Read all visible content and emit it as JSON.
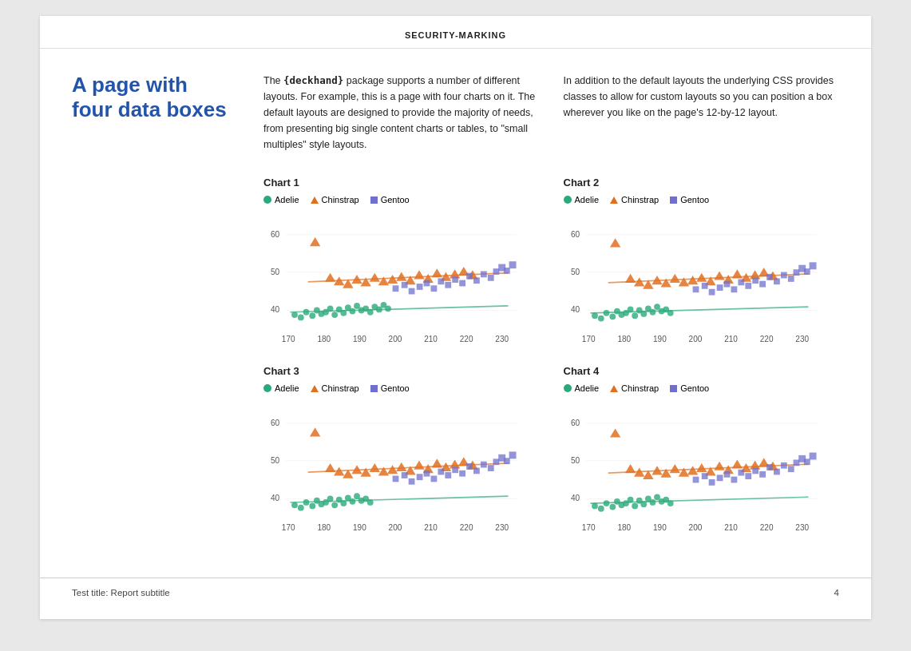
{
  "security_marking": "SECURITY-MARKING",
  "page_title": "A page with four data boxes",
  "text_col1": "The {deckhand} package supports a number of different layouts. For example, this is a page with four charts on it. The default layouts are designed to provide the majority of needs, from presenting big single content charts or tables, to \"small multiples\" style layouts.",
  "text_col1_code": "{deckhand}",
  "text_col2": "In addition to the default layouts the underlying CSS provides classes to allow for custom layouts so you can position a box wherever you like on the page's 12-by-12 layout.",
  "charts": [
    {
      "id": "chart1",
      "title": "Chart 1"
    },
    {
      "id": "chart2",
      "title": "Chart 2"
    },
    {
      "id": "chart3",
      "title": "Chart 3"
    },
    {
      "id": "chart4",
      "title": "Chart 4"
    }
  ],
  "legend": {
    "adelie_label": "Adelie",
    "adelie_color": "#2aaa7a",
    "chinstrap_label": "Chinstrap",
    "chinstrap_color": "#e07020",
    "gentoo_label": "Gentoo",
    "gentoo_color": "#7070cc"
  },
  "axis": {
    "y_labels": [
      "60",
      "50",
      "40"
    ],
    "x_labels": [
      "170",
      "180",
      "190",
      "200",
      "210",
      "220",
      "230"
    ]
  },
  "footer": {
    "left": "Test title: Report subtitle",
    "right": "4"
  }
}
